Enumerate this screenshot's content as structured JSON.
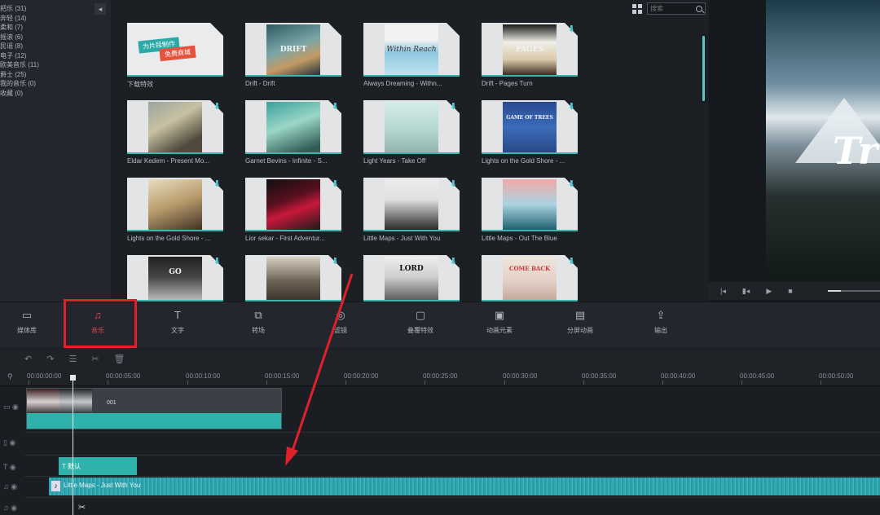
{
  "sidebar": {
    "collapse_glyph": "◂",
    "categories": [
      "把乐 (31)",
      "奔轻 (14)",
      "柔和 (7)",
      "摇滚 (6)",
      "民谣 (8)",
      "电子 (12)",
      "欧美音乐 (11)",
      "爵士 (25)",
      "我的音乐 (0)",
      "收藏 (0)"
    ]
  },
  "grid": {
    "search_placeholder": "搜索",
    "items": [
      {
        "label": "下载特效",
        "art_text": "",
        "download": false
      },
      {
        "label": "Drift - Drift",
        "art_text": "DRIFT",
        "download": false
      },
      {
        "label": "Always Dreaming - Withn...",
        "art_text": "Within Reach",
        "download": false
      },
      {
        "label": "Drift - Pages Turn",
        "art_text": "PAGES",
        "download": true
      },
      {
        "label": "Eldar Kedem - Present Mo...",
        "art_text": "",
        "download": true
      },
      {
        "label": "Garnet Bevins - Infinite - S...",
        "art_text": "",
        "download": true
      },
      {
        "label": "Light Years - Take Off",
        "art_text": "",
        "download": true
      },
      {
        "label": "Lights on the Gold Shore - ...",
        "art_text": "GAME OF TREES",
        "download": true
      },
      {
        "label": "Lights on the Gold Shore - ...",
        "art_text": "",
        "download": true
      },
      {
        "label": "Lior sekar - First Adventur...",
        "art_text": "",
        "download": true
      },
      {
        "label": "Little Maps - Just With You",
        "art_text": "",
        "download": true
      },
      {
        "label": "Little Maps - Out The Blue",
        "art_text": "",
        "download": true
      },
      {
        "label": "",
        "art_text": "GO",
        "download": true
      },
      {
        "label": "",
        "art_text": "",
        "download": true
      },
      {
        "label": "",
        "art_text": "LORD",
        "download": true
      },
      {
        "label": "",
        "art_text": "COME BACK",
        "download": true
      }
    ]
  },
  "first_tile": {
    "ribbon_top": "为片段制作",
    "ribbon_bottom": "免费商城"
  },
  "preview": {
    "title_text": "Tr",
    "controls": [
      "|◂",
      "▮◂",
      "▶",
      "■"
    ]
  },
  "toolbar": {
    "items": [
      {
        "label": "媒体库",
        "icon": "folder-icon",
        "glyph": "▭"
      },
      {
        "label": "音乐",
        "icon": "music-note-icon",
        "glyph": "♫"
      },
      {
        "label": "文字",
        "icon": "text-icon",
        "glyph": "T"
      },
      {
        "label": "转场",
        "icon": "transition-icon",
        "glyph": "⧉"
      },
      {
        "label": "滤镜",
        "icon": "filter-icon",
        "glyph": "◎"
      },
      {
        "label": "叠覆特效",
        "icon": "overlay-icon",
        "glyph": "▢"
      },
      {
        "label": "动画元素",
        "icon": "element-icon",
        "glyph": "▣"
      },
      {
        "label": "分屏动画",
        "icon": "split-screen-icon",
        "glyph": "▤"
      },
      {
        "label": "输出",
        "icon": "export-icon",
        "glyph": "⇪"
      }
    ],
    "active": "音乐"
  },
  "timeline": {
    "tools": [
      "↶",
      "↷",
      "☰",
      "✂",
      "🗑"
    ],
    "ticks": [
      "00:00:00:00",
      "00:00:05:00",
      "00:00:10:00",
      "00:00:15:00",
      "00:00:20:00",
      "00:00:25:00",
      "00:00:30:00",
      "00:00:35:00",
      "00:00:40:00",
      "00:00:45:00",
      "00:00:50:00"
    ],
    "video_clip": "001",
    "text_clip": "T 默认",
    "audio_clip": "Little Maps - Just With You"
  },
  "colors": {
    "accent": "#2fb2ac",
    "active": "#e04458",
    "annotation": "#e0202a"
  }
}
